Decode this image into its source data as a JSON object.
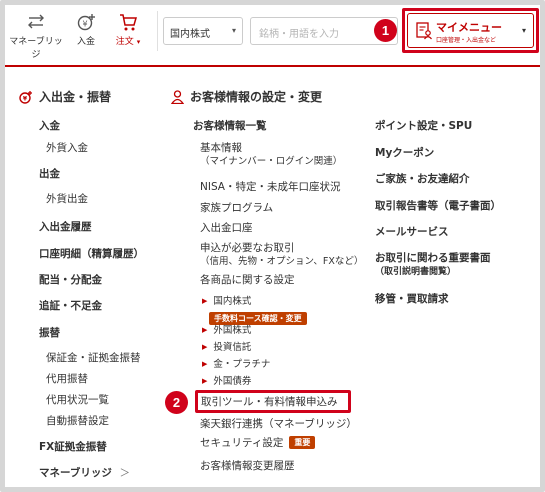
{
  "header": {
    "icons": [
      {
        "label": "マネーブリッジ",
        "icon": "money-bridge-icon"
      },
      {
        "label": "入金",
        "icon": "deposit-icon"
      },
      {
        "label": "注文",
        "icon": "cart-icon"
      }
    ],
    "order_caret": "▾",
    "market_select": {
      "value": "国内株式",
      "caret": "▾"
    },
    "search": {
      "placeholder": "銘柄・用語を入力"
    },
    "mymenu": {
      "title": "マイメニュー",
      "subtitle": "口座管理・入出金など",
      "caret": "▾"
    },
    "badge1": "1"
  },
  "col1": {
    "title": "入出金・振替",
    "items": [
      "入金",
      "外貨入金",
      "出金",
      "外貨出金",
      "入出金履歴",
      "口座明細（精算履歴）",
      "配当・分配金",
      "追証・不足金",
      "振替",
      "保証金・証拠金振替",
      "代用振替",
      "代用状況一覧",
      "自動振替設定",
      "FX証拠金振替",
      "マネーブリッジ"
    ],
    "arrow": "＞"
  },
  "col2": {
    "title": "お客様情報の設定・変更",
    "heading": "お客様情報一覧",
    "basic": {
      "label": "基本情報",
      "note": "（マイナンバー・ログイン関連）"
    },
    "nisa": "NISA・特定・未成年口座状況",
    "family": "家族プログラム",
    "bank": "入出金口座",
    "apply": {
      "label": "申込が必要なお取引",
      "note": "（信用、先物・オプション、FXなど）"
    },
    "settings": "各商品に関する設定",
    "products": [
      "国内株式",
      "外国株式",
      "投資信託",
      "金・プラチナ",
      "外国債券"
    ],
    "fee_tag": "手数料コース確認・変更",
    "tools": "取引ツール・有料情報申込み",
    "rakuten_bank": "楽天銀行連携（マネーブリッジ）",
    "security": "セキュリティ設定",
    "security_tag": "重要",
    "history": "お客様情報変更履歴",
    "badge2": "2"
  },
  "col3": {
    "items": [
      "ポイント設定・SPU",
      "Myクーポン",
      "ご家族・お友達紹介",
      "取引報告書等（電子書面）",
      "メールサービス"
    ],
    "important": {
      "label": "お取引に関わる重要書面",
      "note": "（取引説明書閲覧）"
    },
    "transfer": "移管・買取請求"
  },
  "colors": {
    "accent": "#bf0000",
    "highlight": "#d0021b",
    "tag": "#bf3f00"
  }
}
